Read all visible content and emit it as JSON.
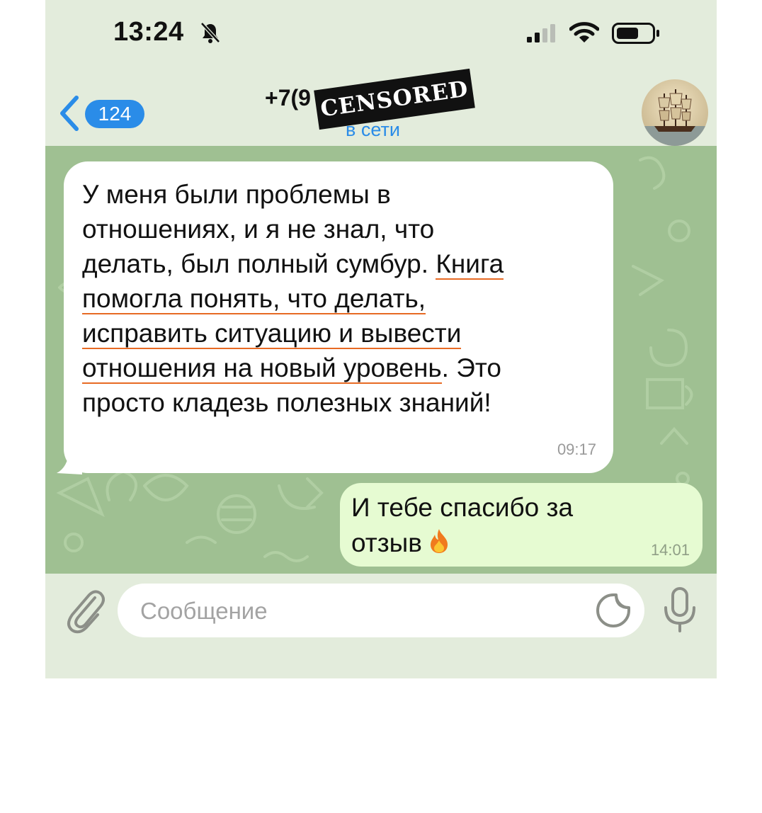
{
  "status_bar": {
    "time": "13:24",
    "icons": [
      "bell-slash-icon",
      "cellular-signal-icon",
      "wifi-icon",
      "battery-icon"
    ]
  },
  "header": {
    "back_icon": "chevron-left-icon",
    "unread_count": "124",
    "title": "+7(9              -52",
    "censor_stamp": "CENSORED",
    "status": "в сети",
    "avatar": "ship-painting-avatar"
  },
  "messages": [
    {
      "direction": "incoming",
      "lines": [
        [
          "У меня были проблемы в"
        ],
        [
          "отношениях, и я не знал, что"
        ],
        [
          "делать, был полный сумбур. ",
          "Книга"
        ],
        [
          "помогла понять, что делать,"
        ],
        [
          "исправить ситуацию и вывести"
        ],
        [
          "отношения на новый уровень",
          ". Это"
        ],
        [
          "просто кладезь полезных знаний!"
        ]
      ],
      "time": "09:17",
      "highlight_color": "#e76a24"
    },
    {
      "direction": "outgoing",
      "lines": [
        "И тебе спасибо за",
        "отзыв"
      ],
      "emoji": "fire-icon",
      "time": "14:01"
    }
  ],
  "composer": {
    "placeholder": "Сообщение",
    "value": "",
    "attach_icon": "paperclip-icon",
    "sticker_icon": "sticker-icon",
    "mic_icon": "microphone-icon"
  },
  "colors": {
    "accent": "#2a8ce8",
    "chat_background": "#9fc092",
    "incoming_bubble": "#ffffff",
    "outgoing_bubble": "#e6fbd2"
  }
}
